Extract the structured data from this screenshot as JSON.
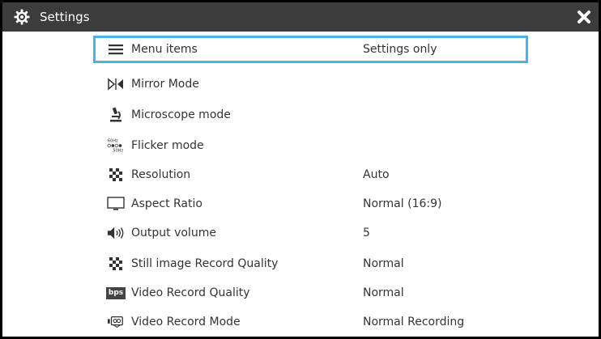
{
  "window": {
    "title": "Settings",
    "icon": "gear-icon",
    "close_icon": "close-icon"
  },
  "colors": {
    "titlebar": "#3c3c3c",
    "selection_border": "#4ab4e6",
    "text": "#333333"
  },
  "menu": {
    "items": [
      {
        "label": "Menu items",
        "value": "Settings only",
        "icon": "menu-icon",
        "selected": true
      },
      {
        "label": "Mirror Mode",
        "value": "",
        "icon": "mirror-icon",
        "selected": false
      },
      {
        "label": "Microscope mode",
        "value": "",
        "icon": "microscope-icon",
        "selected": false
      },
      {
        "label": "Flicker mode",
        "value": "",
        "icon": "flicker-icon",
        "selected": false,
        "icon_text_top": "60Hz",
        "icon_text_bottom": "50Hz"
      },
      {
        "label": "Resolution",
        "value": "Auto",
        "icon": "resolution-icon",
        "selected": false
      },
      {
        "label": "Aspect Ratio",
        "value": "Normal (16:9)",
        "icon": "monitor-icon",
        "selected": false
      },
      {
        "label": "Output volume",
        "value": "5",
        "icon": "speaker-icon",
        "selected": false
      },
      {
        "label": "Still image Record Quality",
        "value": "Normal",
        "icon": "image-quality-icon",
        "selected": false
      },
      {
        "label": "Video Record Quality",
        "value": "Normal",
        "icon": "bps-icon",
        "selected": false,
        "icon_text": "bps"
      },
      {
        "label": "Video Record Mode",
        "value": "Normal Recording",
        "icon": "video-mode-icon",
        "selected": false
      }
    ]
  }
}
